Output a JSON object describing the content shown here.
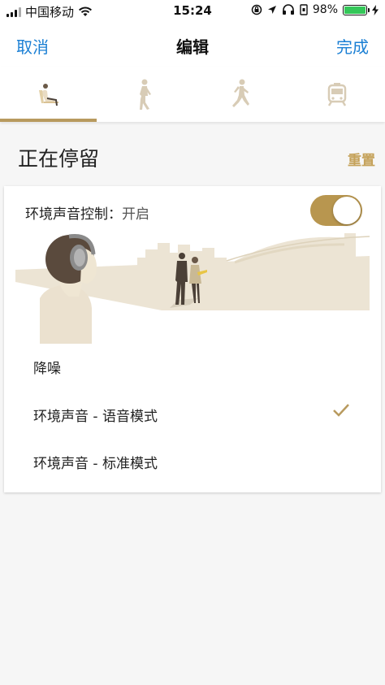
{
  "status_bar": {
    "carrier": "中国移动",
    "time": "15:24",
    "battery_percent": "98%"
  },
  "nav": {
    "cancel": "取消",
    "title": "编辑",
    "done": "完成"
  },
  "tabs": [
    {
      "icon": "sitting-person-icon",
      "active": true
    },
    {
      "icon": "walking-person-icon",
      "active": false
    },
    {
      "icon": "running-person-icon",
      "active": false
    },
    {
      "icon": "train-icon",
      "active": false
    }
  ],
  "section": {
    "title": "正在停留",
    "reset": "重置"
  },
  "ambient": {
    "label": "环境声音控制：",
    "state": "开启",
    "toggle_on": true
  },
  "options": [
    {
      "label": "降噪",
      "selected": false
    },
    {
      "label": "环境声音 - 语音模式",
      "selected": true
    },
    {
      "label": "环境声音 - 标准模式",
      "selected": false
    }
  ],
  "colors": {
    "accent": "#b89a5e",
    "link": "#1a7fd4",
    "reset": "#c5a25a"
  }
}
